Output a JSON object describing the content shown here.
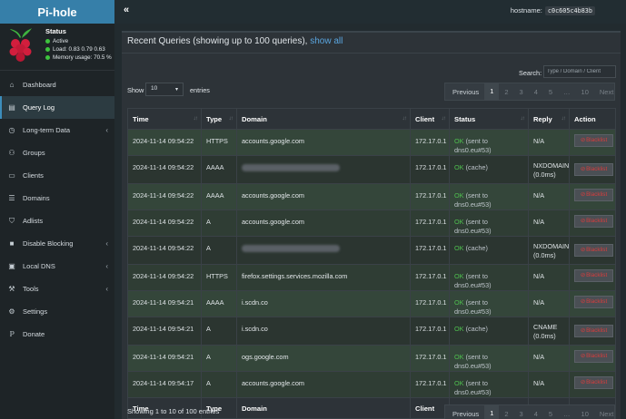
{
  "sidebar": {
    "logo": "Pi-hole",
    "status": {
      "title": "Status",
      "active": "Active",
      "load": "Load:  0.83  0.79  0.63",
      "memory": "Memory usage:  70.5 %"
    },
    "items": [
      {
        "label": "Dashboard",
        "icon": "home-icon"
      },
      {
        "label": "Query Log",
        "icon": "file-icon"
      },
      {
        "label": "Long-term Data",
        "icon": "clock-icon"
      },
      {
        "label": "Groups",
        "icon": "users-icon"
      },
      {
        "label": "Clients",
        "icon": "laptop-icon"
      },
      {
        "label": "Domains",
        "icon": "list-icon"
      },
      {
        "label": "Adlists",
        "icon": "shield-icon"
      },
      {
        "label": "Disable Blocking",
        "icon": "stop-icon"
      },
      {
        "label": "Local DNS",
        "icon": "address-book-icon"
      },
      {
        "label": "Tools",
        "icon": "wrench-icon"
      },
      {
        "label": "Settings",
        "icon": "gear-icon"
      },
      {
        "label": "Donate",
        "icon": "paypal-icon"
      }
    ]
  },
  "topbar": {
    "toggle": "«",
    "hostname_label": "hostname:",
    "hostname_value": "c0c605c4b83b"
  },
  "box": {
    "title": "Recent Queries (showing up to 100 queries), ",
    "show_all": "show all",
    "search_label": "Search:",
    "search_placeholder": "Type / Domain / Client",
    "show_label": "Show",
    "show_value": "10",
    "entries_label": "entries",
    "info": "Showing 1 to 10 of 100 entries"
  },
  "pager": {
    "previous": "Previous",
    "pages": [
      "1",
      "2",
      "3",
      "4",
      "5",
      "…",
      "10"
    ],
    "next": "Next"
  },
  "table": {
    "headers": [
      "Time",
      "Type",
      "Domain",
      "Client",
      "Status",
      "Reply",
      "Action"
    ],
    "rows": [
      {
        "time": "2024-11-14 09:54:22",
        "type": "HTTPS",
        "domain": "accounts.google.com",
        "client": "172.17.0.1",
        "ok": "OK",
        "status": "(sent to dns0.eu#53)",
        "reply": "N/A",
        "reply2": "",
        "action": "Blacklist"
      },
      {
        "time": "2024-11-14 09:54:22",
        "type": "AAAA",
        "domain": "",
        "client": "172.17.0.1",
        "ok": "OK",
        "status": "(cache)",
        "reply": "NXDOMAIN",
        "reply2": "(0.0ms)",
        "action": "Blacklist"
      },
      {
        "time": "2024-11-14 09:54:22",
        "type": "AAAA",
        "domain": "accounts.google.com",
        "client": "172.17.0.1",
        "ok": "OK",
        "status": "(sent to dns0.eu#53)",
        "reply": "N/A",
        "reply2": "",
        "action": "Blacklist"
      },
      {
        "time": "2024-11-14 09:54:22",
        "type": "A",
        "domain": "accounts.google.com",
        "client": "172.17.0.1",
        "ok": "OK",
        "status": "(sent to dns0.eu#53)",
        "reply": "N/A",
        "reply2": "",
        "action": "Blacklist"
      },
      {
        "time": "2024-11-14 09:54:22",
        "type": "A",
        "domain": "",
        "client": "172.17.0.1",
        "ok": "OK",
        "status": "(cache)",
        "reply": "NXDOMAIN",
        "reply2": "(0.0ms)",
        "action": "Blacklist"
      },
      {
        "time": "2024-11-14 09:54:22",
        "type": "HTTPS",
        "domain": "firefox.settings.services.mozilla.com",
        "client": "172.17.0.1",
        "ok": "OK",
        "status": "(sent to dns0.eu#53)",
        "reply": "N/A",
        "reply2": "",
        "action": "Blacklist"
      },
      {
        "time": "2024-11-14 09:54:21",
        "type": "AAAA",
        "domain": "i.scdn.co",
        "client": "172.17.0.1",
        "ok": "OK",
        "status": "(sent to dns0.eu#53)",
        "reply": "N/A",
        "reply2": "",
        "action": "Blacklist"
      },
      {
        "time": "2024-11-14 09:54:21",
        "type": "A",
        "domain": "i.scdn.co",
        "client": "172.17.0.1",
        "ok": "OK",
        "status": "(cache)",
        "reply": "CNAME",
        "reply2": "(0.0ms)",
        "action": "Blacklist"
      },
      {
        "time": "2024-11-14 09:54:21",
        "type": "A",
        "domain": "ogs.google.com",
        "client": "172.17.0.1",
        "ok": "OK",
        "status": "(sent to dns0.eu#53)",
        "reply": "N/A",
        "reply2": "",
        "action": "Blacklist"
      },
      {
        "time": "2024-11-14 09:54:17",
        "type": "A",
        "domain": "accounts.google.com",
        "client": "172.17.0.1",
        "ok": "OK",
        "status": "(sent to dns0.eu#53)",
        "reply": "N/A",
        "reply2": "",
        "action": "Blacklist"
      }
    ]
  }
}
